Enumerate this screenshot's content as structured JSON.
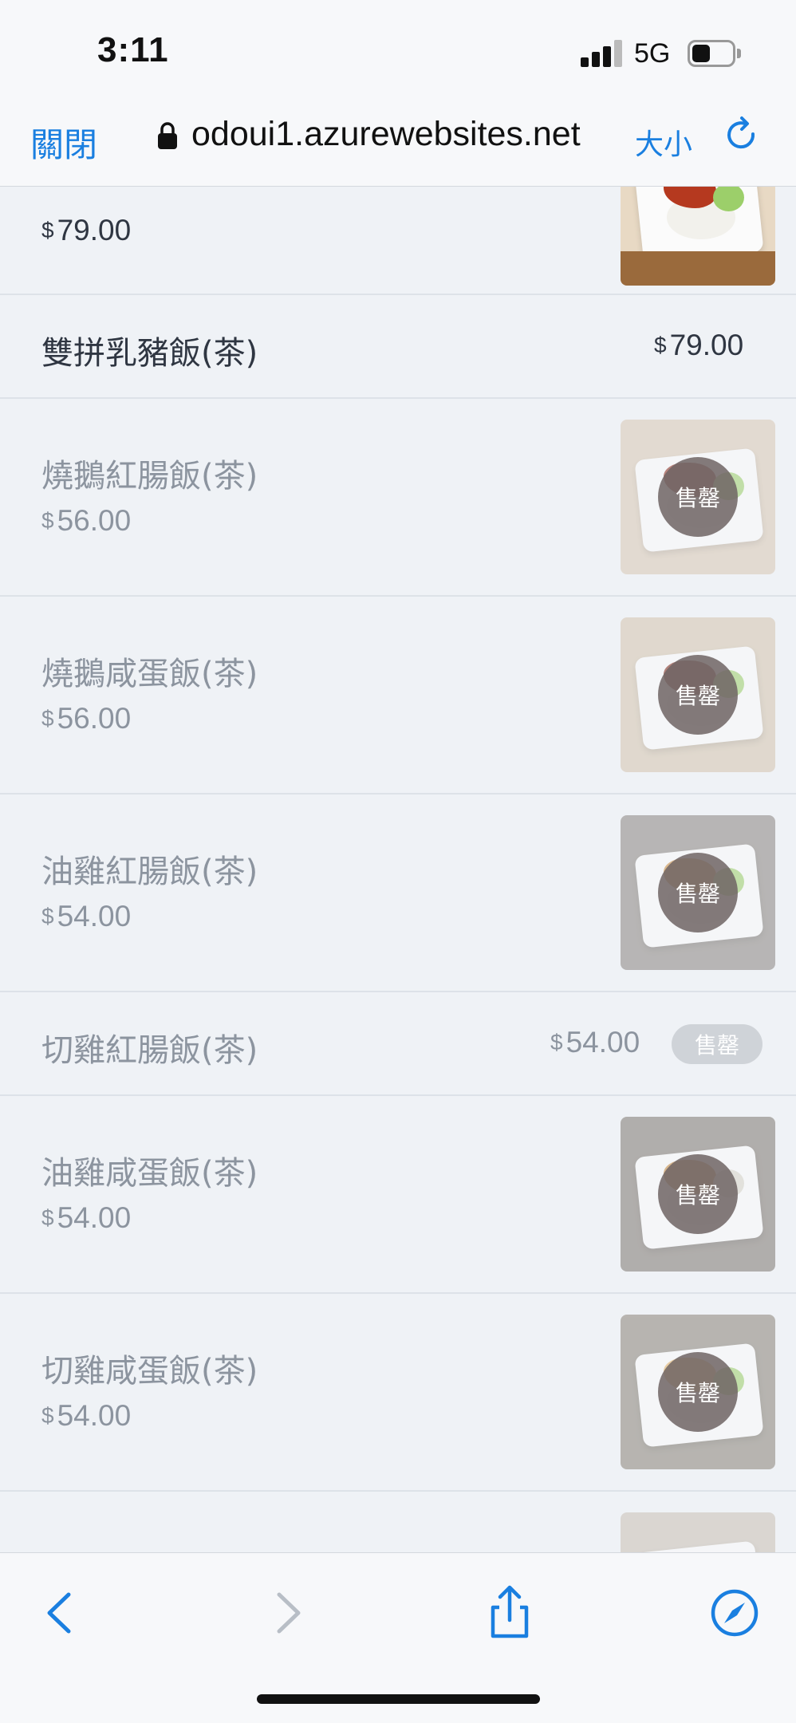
{
  "status_bar": {
    "time": "3:11",
    "network": "5G",
    "battery_level": 0.45
  },
  "browser": {
    "close_label": "關閉",
    "url": "odoui1.azurewebsites.net",
    "text_size_label": "大小",
    "accent_color": "#1a7fe0"
  },
  "menu": {
    "currency_symbol": "$",
    "sold_out_label": "售罄",
    "items": [
      {
        "name": "",
        "price": "79.00",
        "has_image": true,
        "sold_out": false,
        "meat_color": "#b5391f"
      },
      {
        "name": "雙拼乳豬飯(茶)",
        "price": "79.00",
        "has_image": false,
        "sold_out": false
      },
      {
        "name": "燒鵝紅腸飯(茶)",
        "price": "56.00",
        "has_image": true,
        "sold_out": true,
        "meat_color": "#8a2a1a"
      },
      {
        "name": "燒鵝咸蛋飯(茶)",
        "price": "56.00",
        "has_image": true,
        "sold_out": true,
        "meat_color": "#7d2616"
      },
      {
        "name": "油雞紅腸飯(茶)",
        "price": "54.00",
        "has_image": true,
        "sold_out": true,
        "meat_color": "#c98a3a"
      },
      {
        "name": "切雞紅腸飯(茶)",
        "price": "54.00",
        "has_image": false,
        "sold_out": true
      },
      {
        "name": "油雞咸蛋飯(茶)",
        "price": "54.00",
        "has_image": true,
        "sold_out": true,
        "meat_color": "#c7873a"
      },
      {
        "name": "切雞咸蛋飯(茶)",
        "price": "54.00",
        "has_image": true,
        "sold_out": true,
        "meat_color": "#e3b062"
      }
    ]
  },
  "toolbar": {
    "back_icon": "chevron-left-icon",
    "forward_icon": "chevron-right-icon",
    "share_icon": "share-icon",
    "compass_icon": "compass-icon"
  }
}
